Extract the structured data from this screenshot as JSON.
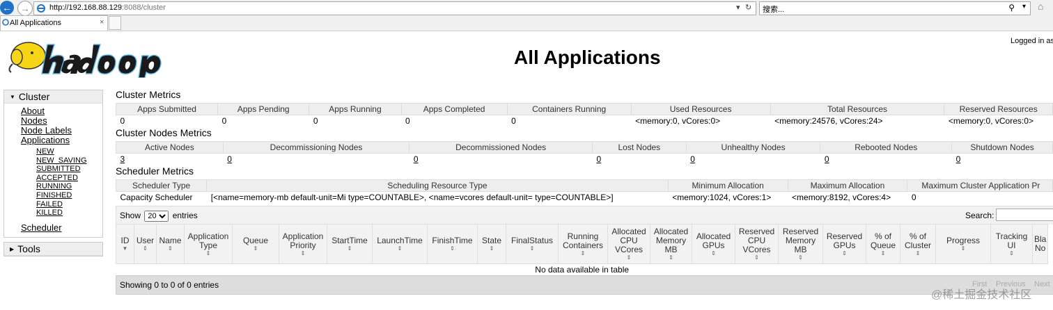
{
  "browser": {
    "url_host": "http://192.168.88.129",
    "url_rest": ":8088/cluster",
    "search_placeholder": "搜索...",
    "tab_title": "All Applications",
    "tab_close": "×"
  },
  "header": {
    "page_title": "All Applications",
    "logged_in": "Logged in as"
  },
  "sidebar": {
    "cluster_label": "Cluster",
    "links": [
      "About",
      "Nodes",
      "Node Labels",
      "Applications"
    ],
    "app_states": [
      "NEW",
      "NEW_SAVING",
      "SUBMITTED",
      "ACCEPTED",
      "RUNNING",
      "FINISHED",
      "FAILED",
      "KILLED"
    ],
    "scheduler": "Scheduler",
    "tools_label": "Tools"
  },
  "cluster_metrics": {
    "title": "Cluster Metrics",
    "headers": [
      "Apps Submitted",
      "Apps Pending",
      "Apps Running",
      "Apps Completed",
      "Containers Running",
      "Used Resources",
      "Total Resources",
      "Reserved Resources"
    ],
    "values": [
      "0",
      "0",
      "0",
      "0",
      "0",
      "<memory:0, vCores:0>",
      "<memory:24576, vCores:24>",
      "<memory:0, vCores:0>"
    ]
  },
  "node_metrics": {
    "title": "Cluster Nodes Metrics",
    "headers": [
      "Active Nodes",
      "Decommissioning Nodes",
      "Decommissioned Nodes",
      "Lost Nodes",
      "Unhealthy Nodes",
      "Rebooted Nodes",
      "Shutdown Nodes"
    ],
    "values": [
      "3",
      "0",
      "0",
      "0",
      "0",
      "0",
      "0"
    ]
  },
  "scheduler_metrics": {
    "title": "Scheduler Metrics",
    "headers": [
      "Scheduler Type",
      "Scheduling Resource Type",
      "Minimum Allocation",
      "Maximum Allocation",
      "Maximum Cluster Application Pr"
    ],
    "values": [
      "Capacity Scheduler",
      "[<name=memory-mb default-unit=Mi type=COUNTABLE>, <name=vcores default-unit= type=COUNTABLE>]",
      "<memory:1024, vCores:1>",
      "<memory:8192, vCores:4>",
      "0"
    ]
  },
  "apps_table": {
    "show_label": "Show",
    "entries_value": "20",
    "entries_label": "entries",
    "search_label": "Search:",
    "columns": [
      "ID",
      "User",
      "Name",
      "Application Type",
      "Queue",
      "Application Priority",
      "StartTime",
      "LaunchTime",
      "FinishTime",
      "State",
      "FinalStatus",
      "Running Containers",
      "Allocated CPU VCores",
      "Allocated Memory MB",
      "Allocated GPUs",
      "Reserved CPU VCores",
      "Reserved Memory MB",
      "Reserved GPUs",
      "% of Queue",
      "% of Cluster",
      "Progress",
      "Tracking UI",
      "Bla No"
    ],
    "empty_message": "No data available in table",
    "info": "Showing 0 to 0 of 0 entries",
    "pager": [
      "First",
      "Previous",
      "Next"
    ]
  },
  "watermark": "@稀土掘金技术社区",
  "colors": {
    "nav_blue": "#1f73c8",
    "header_grey": "#eeeeee",
    "logo_yellow": "#f5d516"
  }
}
